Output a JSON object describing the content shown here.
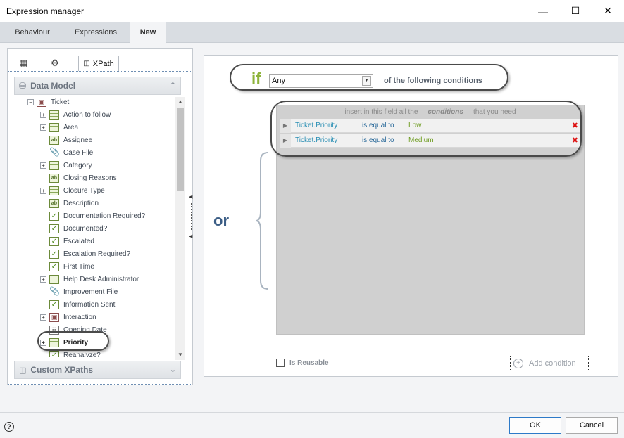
{
  "window": {
    "title": "Expression manager"
  },
  "tabs": [
    {
      "label": "Behaviour"
    },
    {
      "label": "Expressions"
    },
    {
      "label": "New"
    }
  ],
  "left_panel": {
    "xpath_tab": "XPath",
    "data_model_header": "Data Model",
    "custom_xpaths_header": "Custom XPaths",
    "tree": {
      "root": "Ticket",
      "items": [
        "Action to follow",
        "Area",
        "Assignee",
        "Case File",
        "Category",
        "Closing Reasons",
        "Closure Type",
        "Description",
        "Documentation Required?",
        "Documented?",
        "Escalated",
        "Escalation Required?",
        "First Time",
        "Help Desk Administrator",
        "Improvement File",
        "Information Sent",
        "Interaction",
        "Opening Date",
        "Priority",
        "Reanalyze?"
      ]
    }
  },
  "expression": {
    "if_word": "if",
    "quantifier": "Any",
    "following_text": "of the following conditions",
    "or_word": "or",
    "conditions_hint_pre": "insert in this field all the",
    "conditions_hint_em": "conditions",
    "conditions_hint_post": "that you need",
    "conditions": [
      {
        "field": "Ticket.Priority",
        "operator": "is equal to",
        "value": "Low"
      },
      {
        "field": "Ticket.Priority",
        "operator": "is equal to",
        "value": "Medium"
      }
    ],
    "is_reusable_label": "Is Reusable",
    "add_condition_label": "Add condition"
  },
  "footer": {
    "help": "?",
    "ok_label": "OK",
    "cancel_label": "Cancel"
  }
}
